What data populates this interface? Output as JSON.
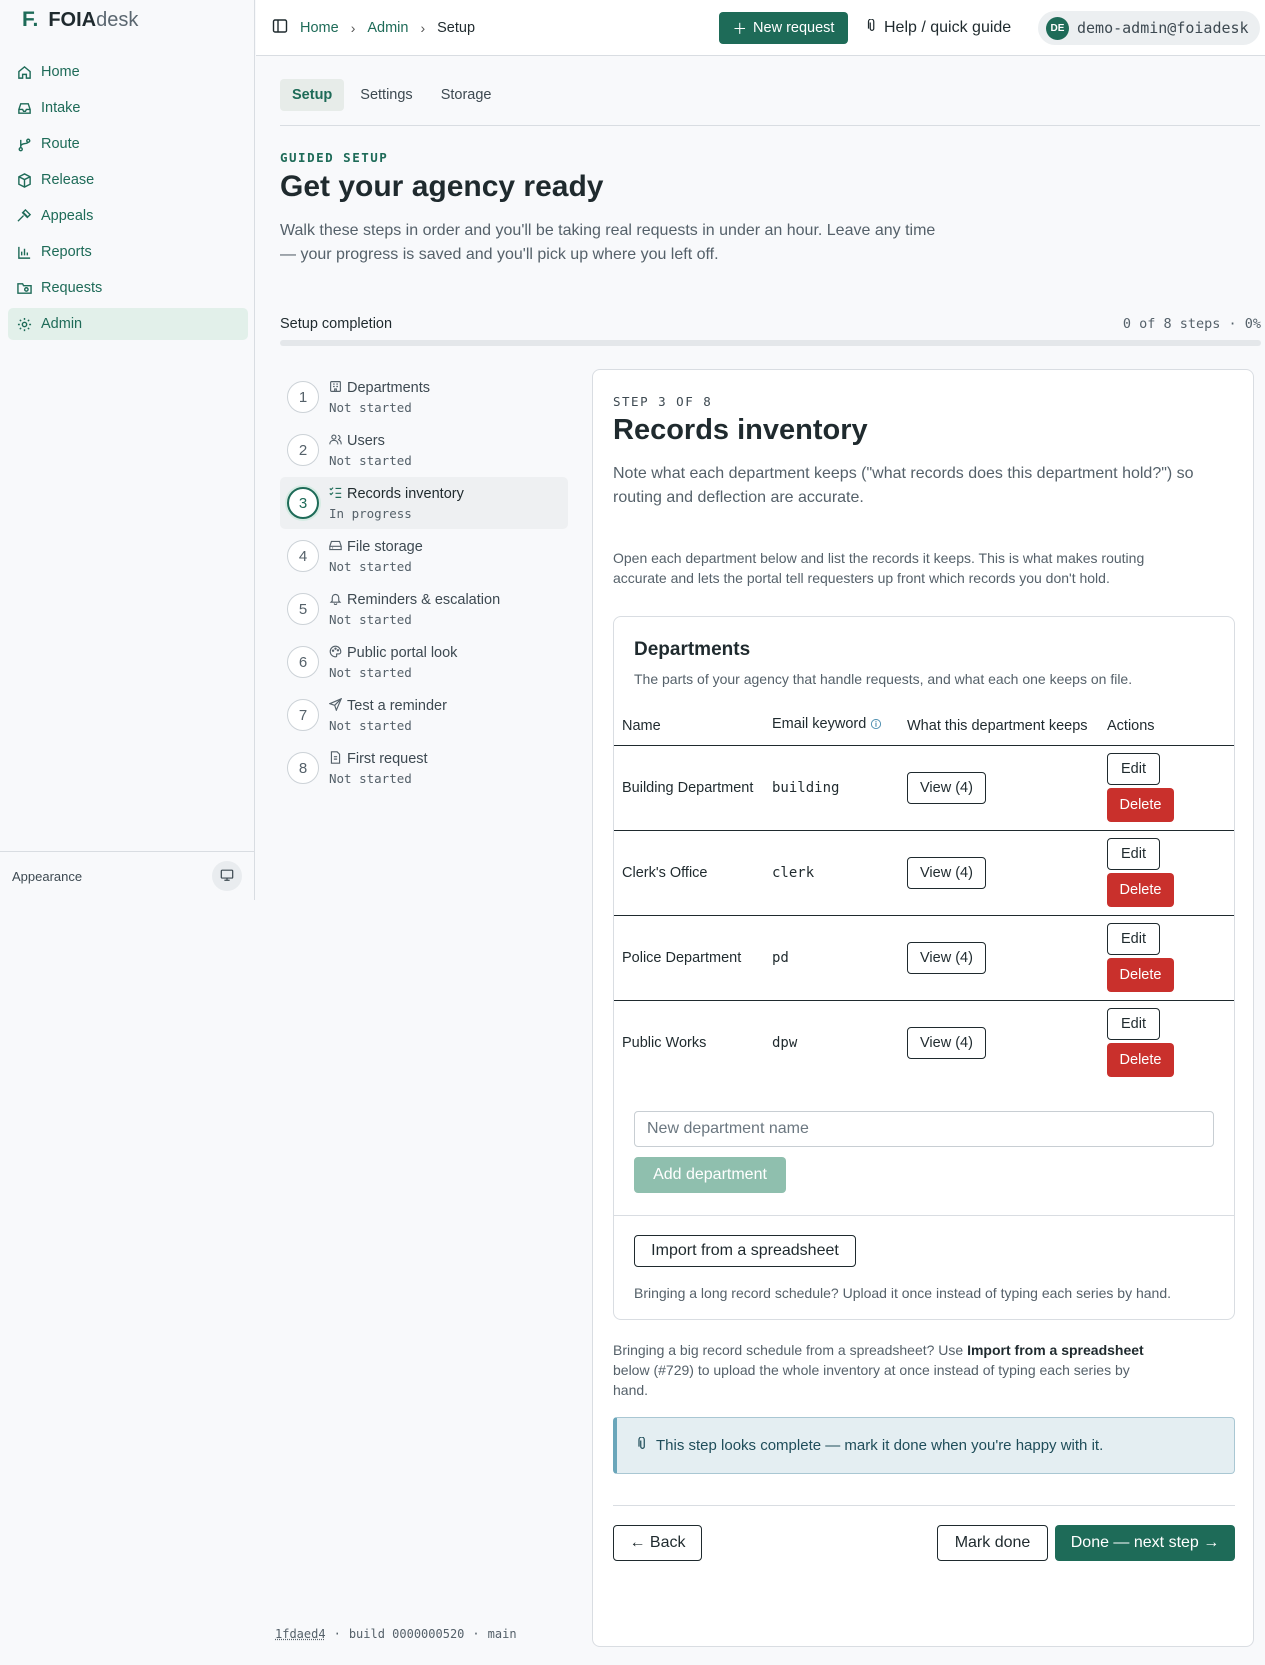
{
  "brand": {
    "mark": "F.",
    "name_bold": "FOIA",
    "name_light": "desk"
  },
  "nav": [
    {
      "label": "Home",
      "icon": "home-icon"
    },
    {
      "label": "Intake",
      "icon": "inbox-icon"
    },
    {
      "label": "Route",
      "icon": "git-branch-icon"
    },
    {
      "label": "Release",
      "icon": "package-icon"
    },
    {
      "label": "Appeals",
      "icon": "gavel-icon"
    },
    {
      "label": "Reports",
      "icon": "bar-chart-icon"
    },
    {
      "label": "Requests",
      "icon": "folder-search-icon"
    },
    {
      "label": "Admin",
      "icon": "gear-icon",
      "active": true
    }
  ],
  "appearance": {
    "label": "Appearance",
    "icon": "monitor-icon"
  },
  "breadcrumb": {
    "home": "Home",
    "admin": "Admin",
    "current": "Setup"
  },
  "header": {
    "new_request": "New request",
    "help": "Help / quick guide",
    "avatar": "DE",
    "email": "demo-admin@foiadesk"
  },
  "tabs": [
    {
      "label": "Setup",
      "active": true
    },
    {
      "label": "Settings"
    },
    {
      "label": "Storage"
    }
  ],
  "intro": {
    "eyebrow": "GUIDED SETUP",
    "title": "Get your agency ready",
    "lede": "Walk these steps in order and you'll be taking real requests in under an hour. Leave any time — your progress is saved and you'll pick up where you left off."
  },
  "progress": {
    "label": "Setup completion",
    "count": "0 of 8 steps · 0%",
    "percent": 0
  },
  "steps": [
    {
      "num": "1",
      "title": "Departments",
      "status": "Not started",
      "icon": "building-icon"
    },
    {
      "num": "2",
      "title": "Users",
      "status": "Not started",
      "icon": "users-icon"
    },
    {
      "num": "3",
      "title": "Records inventory",
      "status": "In progress",
      "icon": "list-check-icon",
      "active": true
    },
    {
      "num": "4",
      "title": "File storage",
      "status": "Not started",
      "icon": "hard-drive-icon"
    },
    {
      "num": "5",
      "title": "Reminders & escalation",
      "status": "Not started",
      "icon": "bell-icon"
    },
    {
      "num": "6",
      "title": "Public portal look",
      "status": "Not started",
      "icon": "palette-icon"
    },
    {
      "num": "7",
      "title": "Test a reminder",
      "status": "Not started",
      "icon": "send-icon"
    },
    {
      "num": "8",
      "title": "First request",
      "status": "Not started",
      "icon": "file-icon"
    }
  ],
  "card": {
    "eyebrow": "STEP 3 OF 8",
    "title": "Records inventory",
    "lede": "Note what each department keeps (\"what records does this department hold?\") so routing and deflection are accurate.",
    "para": "Open each department below and list the records it keeps. This is what makes routing accurate and lets the portal tell requesters up front which records you don't hold."
  },
  "departments": {
    "title": "Departments",
    "subtitle": "The parts of your agency that handle requests, and what each one keeps on file.",
    "columns": [
      "Name",
      "Email keyword",
      "What this department keeps",
      "Actions"
    ],
    "rows": [
      {
        "name": "Building Department",
        "keyword": "building",
        "view": "View (4)",
        "edit": "Edit",
        "delete": "Delete"
      },
      {
        "name": "Clerk's Office",
        "keyword": "clerk",
        "view": "View (4)",
        "edit": "Edit",
        "delete": "Delete"
      },
      {
        "name": "Police Department",
        "keyword": "pd",
        "view": "View (4)",
        "edit": "Edit",
        "delete": "Delete"
      },
      {
        "name": "Public Works",
        "keyword": "dpw",
        "view": "View (4)",
        "edit": "Edit",
        "delete": "Delete"
      }
    ],
    "new_placeholder": "New department name",
    "add_label": "Add department",
    "import_label": "Import from a spreadsheet",
    "import_note": "Bringing a long record schedule? Upload it once instead of typing each series by hand."
  },
  "after_note": {
    "before": "Bringing a big record schedule from a spreadsheet? Use ",
    "bold": "Import from a spreadsheet",
    "after": " below (#729) to upload the whole inventory at once instead of typing each series by hand."
  },
  "alert": {
    "text": "This step looks complete — mark it done when you're happy with it.",
    "icon": "clip-icon"
  },
  "footer_buttons": {
    "back": "← Back",
    "mark_done": "Mark done",
    "next": "Done — next step →"
  },
  "build": {
    "hash": "1fdaed4",
    "build": "build 0000000520",
    "branch": "main",
    "sep": "·"
  }
}
